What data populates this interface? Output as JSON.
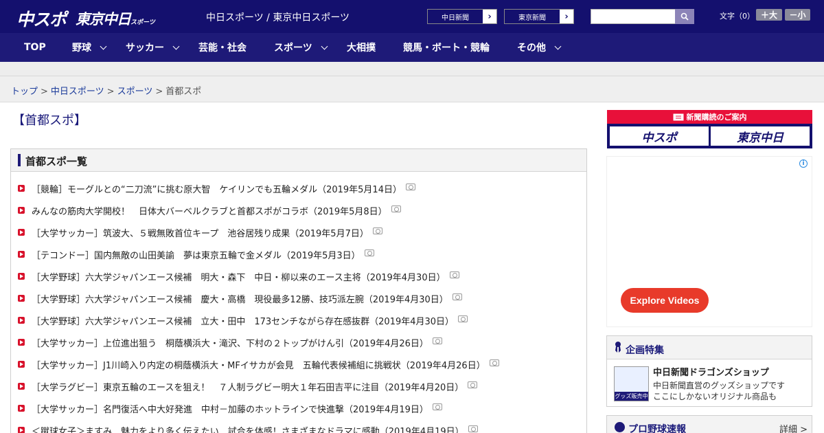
{
  "header": {
    "logo_primary": "中スポ",
    "logo_secondary": "東京中日",
    "logo_secondary_sub": "スポーツ",
    "caption": "中日スポーツ / 東京中日スポーツ",
    "link_chunichi": "中日新聞",
    "link_tokyo": "東京新聞",
    "search_placeholder": "",
    "fontsize_label": "文字（0）",
    "fontsize_up": "＋大",
    "fontsize_down": "－小"
  },
  "nav": {
    "items": [
      {
        "label": "TOP"
      },
      {
        "label": "野球"
      },
      {
        "label": "サッカー"
      },
      {
        "label": "芸能・社会"
      },
      {
        "label": "スポーツ"
      },
      {
        "label": "大相撲"
      },
      {
        "label": "競馬・ボート・競輪"
      },
      {
        "label": "その他"
      }
    ]
  },
  "breadcrumb": {
    "items": [
      "トップ",
      "中日スポーツ",
      "スポーツ"
    ],
    "current": "首都スポ",
    "separator": ">"
  },
  "page_title": "【首都スポ】",
  "list": {
    "heading": "首都スポ一覧",
    "articles": [
      "［競輪］モーグルとの“二刀流”に挑む原大智　ケイリンでも五輪メダル（2019年5月14日）",
      "みんなの筋肉大学開校！　日体大バーベルクラブと首都スポがコラボ（2019年5月8日）",
      "［大学サッカー］筑波大、５戦無敗首位キープ　池谷居残り成果（2019年5月7日）",
      "［テコンドー］国内無敵の山田美諭　夢は東京五輪で金メダル（2019年5月3日）",
      "［大学野球］六大学ジャパンエース候補　明大・森下　中日・柳以来のエース主将（2019年4月30日）",
      "［大学野球］六大学ジャパンエース候補　慶大・高橋　現役最多12勝、技巧派左腕（2019年4月30日）",
      "［大学野球］六大学ジャパンエース候補　立大・田中　173センチながら存在感抜群（2019年4月30日）",
      "［大学サッカー］上位進出狙う　桐蔭横浜大・滝沢、下村の２トップがけん引（2019年4月26日）",
      "［大学サッカー］J1川崎入り内定の桐蔭横浜大・MFイサカが会見　五輪代表候補組に挑戦状（2019年4月26日）",
      "［大学ラグビー］東京五輪のエースを狙え！　７人制ラグビー明大１年石田吉平に注目（2019年4月20日）",
      "［大学サッカー］名門復活へ中大好発進　中村－加藤のホットラインで快進撃（2019年4月19日）",
      "＜蹴球女子＞ますみ　魅力をより多く伝えたい　試合を体感！さまざまなドラマに感動（2019年4月19日）"
    ]
  },
  "subscription": {
    "heading": "新聞購読のご案内",
    "logo_left": "中スポ",
    "logo_right": "東京中日"
  },
  "ad": {
    "button_label": "Explore Videos",
    "info_glyph": "i"
  },
  "feature": {
    "heading": "企画特集",
    "item_title": "中日新聞ドラゴンズショップ",
    "item_desc_line1": "中日新聞直営のグッズショップです",
    "item_desc_line2": "ここにしかないオリジナル商品も",
    "thumb_caption": "グッズ販売中"
  },
  "baseball": {
    "heading": "プロ野球速報",
    "more": "詳細 >"
  },
  "colors": {
    "header_bg": "#14106e",
    "nav_bg": "#1e1a78",
    "bullet": "#d8122b",
    "ad_button": "#e83a2a"
  }
}
